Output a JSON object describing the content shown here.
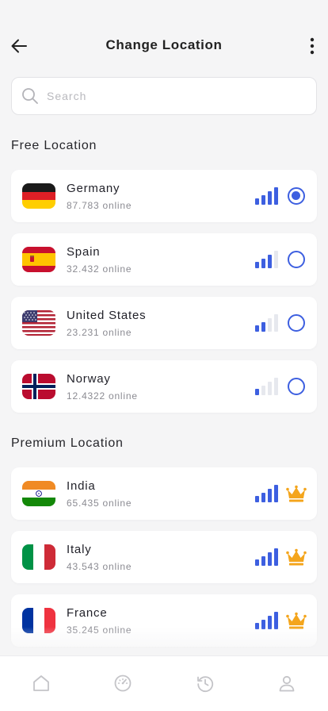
{
  "header": {
    "title": "Change Location",
    "back_icon": "arrow-left-icon",
    "more_icon": "more-vertical-icon"
  },
  "search": {
    "placeholder": "Search",
    "value": "",
    "icon": "search-icon"
  },
  "colors": {
    "accent": "#3d5fe0",
    "crown": "#f4a51c",
    "signal_inactive": "#e6e8ee"
  },
  "sections": [
    {
      "title": "Free Location",
      "items": [
        {
          "country": "Germany",
          "count": "87.783",
          "status": "online",
          "flag": "germany-flag",
          "signal_level": 4,
          "selected": true,
          "action": "radio"
        },
        {
          "country": "Spain",
          "count": "32.432",
          "status": "online",
          "flag": "spain-flag",
          "signal_level": 3,
          "selected": false,
          "action": "radio"
        },
        {
          "country": "United States",
          "count": "23.231",
          "status": "online",
          "flag": "usa-flag",
          "signal_level": 2,
          "selected": false,
          "action": "radio"
        },
        {
          "country": "Norway",
          "count": "12.4322",
          "status": "online",
          "flag": "norway-flag",
          "signal_level": 1,
          "selected": false,
          "action": "radio"
        }
      ]
    },
    {
      "title": "Premium Location",
      "items": [
        {
          "country": "India",
          "count": "65.435",
          "status": "online",
          "flag": "india-flag",
          "signal_level": 4,
          "selected": false,
          "action": "crown"
        },
        {
          "country": "Italy",
          "count": "43.543",
          "status": "online",
          "flag": "italy-flag",
          "signal_level": 4,
          "selected": false,
          "action": "crown"
        },
        {
          "country": "France",
          "count": "35.245",
          "status": "online",
          "flag": "france-flag",
          "signal_level": 4,
          "selected": false,
          "action": "crown"
        }
      ]
    }
  ],
  "bottom_nav": [
    {
      "name": "home",
      "icon": "home-icon"
    },
    {
      "name": "speed",
      "icon": "speedometer-icon"
    },
    {
      "name": "history",
      "icon": "history-icon"
    },
    {
      "name": "profile",
      "icon": "user-icon"
    }
  ]
}
